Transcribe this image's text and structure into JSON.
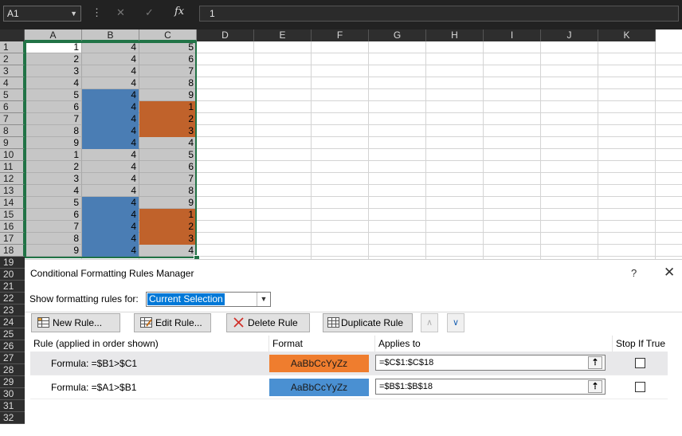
{
  "formula_bar": {
    "name_box": "A1",
    "formula": "1",
    "fx_label": "fx"
  },
  "columns": [
    "A",
    "B",
    "C",
    "D",
    "E",
    "F",
    "G",
    "H",
    "I",
    "J",
    "K"
  ],
  "row_numbers": [
    "1",
    "2",
    "3",
    "4",
    "5",
    "6",
    "7",
    "8",
    "9",
    "10",
    "11",
    "12",
    "13",
    "14",
    "15",
    "16",
    "17",
    "18",
    "19",
    "20",
    "21",
    "22",
    "23",
    "24",
    "25",
    "26",
    "27",
    "28",
    "29",
    "30",
    "31",
    "32"
  ],
  "cells": {
    "A": [
      "1",
      "2",
      "3",
      "4",
      "5",
      "6",
      "7",
      "8",
      "9",
      "1",
      "2",
      "3",
      "4",
      "5",
      "6",
      "7",
      "8",
      "9"
    ],
    "B": [
      "4",
      "4",
      "4",
      "4",
      "4",
      "4",
      "4",
      "4",
      "4",
      "4",
      "4",
      "4",
      "4",
      "4",
      "4",
      "4",
      "4",
      "4"
    ],
    "C": [
      "5",
      "6",
      "7",
      "8",
      "9",
      "1",
      "2",
      "3",
      "4",
      "5",
      "6",
      "7",
      "8",
      "9",
      "1",
      "2",
      "3",
      "4"
    ]
  },
  "colors": {
    "selection_gray": "#c6c6c6",
    "blue_format": "#4a7db4",
    "orange_format": "#c0622b",
    "accent_green": "#217346"
  },
  "dialog": {
    "title": "Conditional Formatting Rules Manager",
    "help": "?",
    "close": "✕",
    "show_label": "Show formatting rules for:",
    "show_value": "Current Selection",
    "buttons": {
      "new_rule": "New Rule...",
      "edit_rule": "Edit Rule...",
      "delete_rule": "Delete Rule",
      "duplicate_rule": "Duplicate Rule"
    },
    "headers": {
      "rule": "Rule (applied in order shown)",
      "format": "Format",
      "applies_to": "Applies to",
      "stop_if_true": "Stop If True"
    },
    "rules": [
      {
        "rule": "Formula: =$B1>$C1",
        "format_preview": "AaBbCcYyZz",
        "format_color": "#ef7d2e",
        "applies_to": "=$C$1:$C$18",
        "stop_if_true": false
      },
      {
        "rule": "Formula: =$A1>$B1",
        "format_preview": "AaBbCcYyZz",
        "format_color": "#4a90d2",
        "applies_to": "=$B$1:$B$18",
        "stop_if_true": false
      }
    ]
  }
}
